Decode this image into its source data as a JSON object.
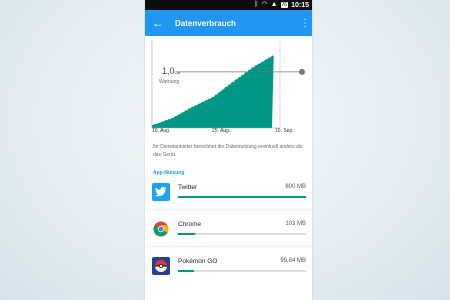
{
  "statusbar": {
    "bluetooth_icon": "bluetooth-icon",
    "wifi_icon": "wifi-icon",
    "signal_icon": "signal-icon",
    "battery": "76",
    "time": "10:15"
  },
  "appbar": {
    "back_icon": "arrow-back-icon",
    "title": "Datenverbrauch",
    "menu_icon": "more-vert-icon",
    "color": "#2196f3"
  },
  "usage_chart": {
    "warning_value": "1,0",
    "warning_unit": "GB",
    "warning_label": "Warnung",
    "x_ticks": [
      "10. Aug.",
      "25. Aug.",
      "10. Sep."
    ],
    "fill_color": "#009688",
    "chart_data": {
      "type": "area",
      "x": [
        "10. Aug.",
        "15. Aug.",
        "20. Aug.",
        "25. Aug.",
        "30. Aug.",
        "4. Sep.",
        "10. Sep."
      ],
      "values": [
        0.05,
        0.18,
        0.38,
        0.55,
        0.82,
        1.08,
        1.29
      ],
      "warning_line": 1.0,
      "ylim": [
        0,
        1.55
      ],
      "grid": false
    }
  },
  "note": "Ihr Dienstanbieter berechnet die Datennutzung eventuell anders als das Gerät.",
  "section_title": "App-Nutzung",
  "apps": [
    {
      "name": "Twitter",
      "usage": "800 MB",
      "icon": "twitter-icon",
      "share": 1.0,
      "color": "#1da1f2"
    },
    {
      "name": "Chrome",
      "usage": "103 MB",
      "icon": "chrome-icon",
      "share": 0.13,
      "color": "#ffffff"
    },
    {
      "name": "Pokémon GO",
      "usage": "99,84 MB",
      "icon": "pokemon-go-icon",
      "share": 0.125,
      "color": "#2a3f8f"
    }
  ]
}
